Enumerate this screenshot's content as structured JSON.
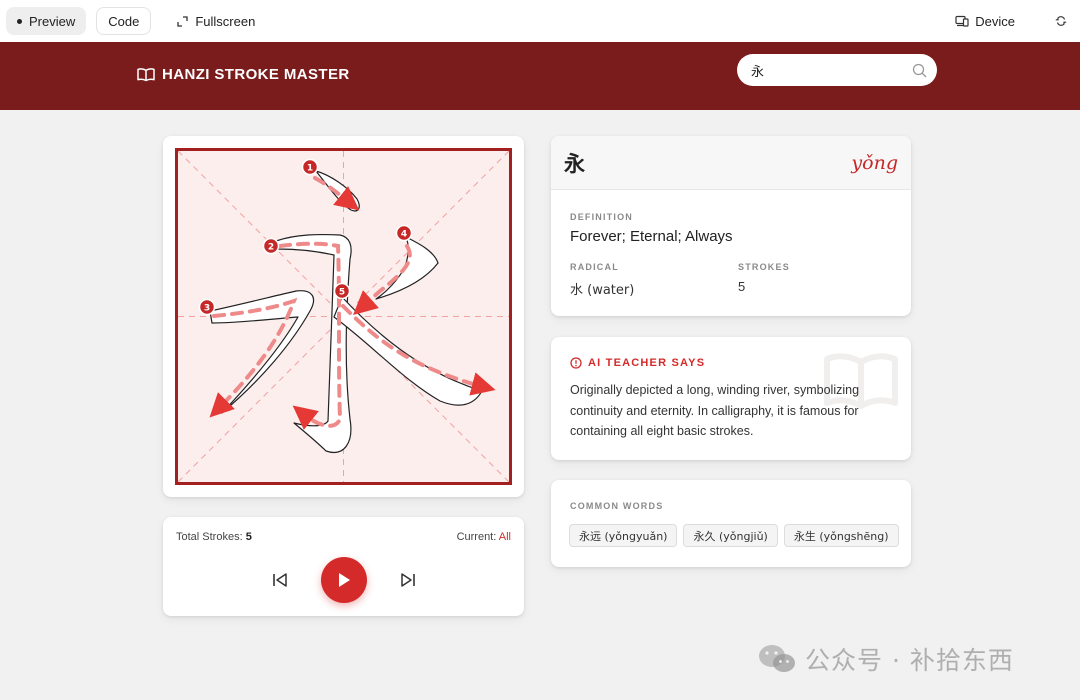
{
  "toolbar": {
    "preview_label": "Preview",
    "code_label": "Code",
    "fullscreen_label": "Fullscreen",
    "device_label": "Device"
  },
  "header": {
    "title": "HANZI STROKE MASTER",
    "search_value": "永",
    "accent_color": "#7a1c1c"
  },
  "practice": {
    "total_strokes_label": "Total Strokes:",
    "total_strokes_value": "5",
    "current_label": "Current:",
    "current_value": "All",
    "stroke_numbers": [
      "1",
      "2",
      "3",
      "4",
      "5"
    ]
  },
  "character": {
    "char": "永",
    "pinyin": "yǒng",
    "definition_label": "DEFINITION",
    "definition": "Forever; Eternal; Always",
    "radical_label": "RADICAL",
    "radical": "水 (water)",
    "strokes_label": "STROKES",
    "strokes": "5"
  },
  "ai": {
    "title": "AI TEACHER SAYS",
    "text": "Originally depicted a long, winding river, symbolizing continuity and eternity. In calligraphy, it is famous for containing all eight basic strokes."
  },
  "words": {
    "label": "COMMON WORDS",
    "items": [
      "永远 (yǒngyuǎn)",
      "永久 (yǒngjiǔ)",
      "永生 (yǒngshēng)"
    ]
  },
  "watermark": {
    "text": "公众号 · 补拾东西"
  },
  "colors": {
    "primary_red": "#d42a2a",
    "header_red": "#7a1c1c",
    "grid_bg": "#fdeeee"
  }
}
